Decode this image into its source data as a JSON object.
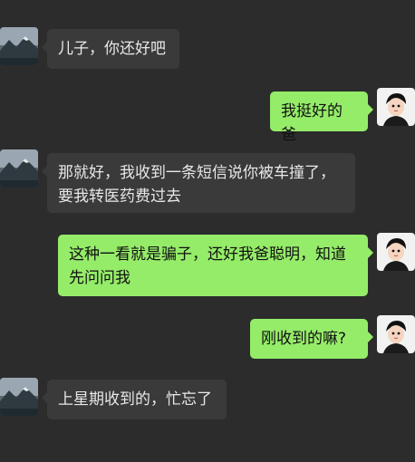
{
  "chat": {
    "messages": [
      {
        "sender": "father",
        "text": "儿子，你还好吧"
      },
      {
        "sender": "son",
        "text": "我挺好的爸"
      },
      {
        "sender": "father",
        "text": "那就好，我收到一条短信说你被车撞了，\n要我转医药费过去"
      },
      {
        "sender": "son",
        "text": "这种一看就是骗子，还好我爸聪明，知道\n先问问我"
      },
      {
        "sender": "son",
        "text": "刚收到的嘛?"
      },
      {
        "sender": "father",
        "text": "上星期收到的，忙忘了"
      }
    ]
  },
  "colors": {
    "background": "#2c2c2c",
    "incoming_bubble": "#3a3a3a",
    "outgoing_bubble": "#95ec69"
  }
}
